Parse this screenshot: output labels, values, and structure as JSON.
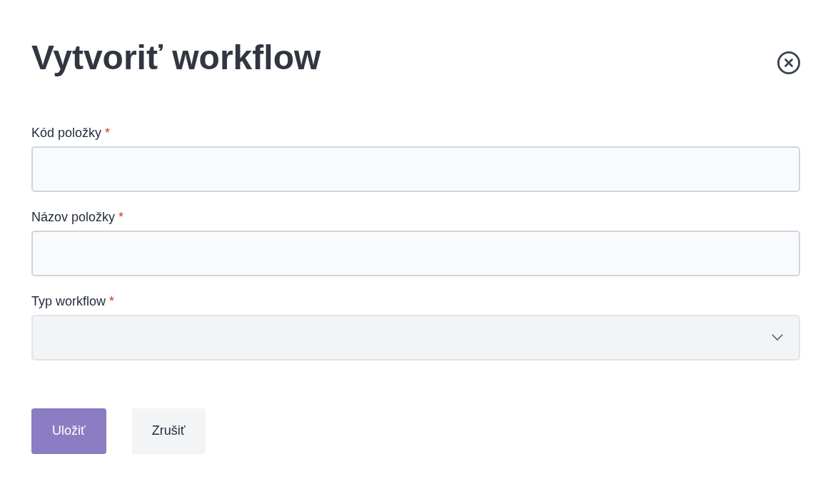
{
  "dialog": {
    "title": "Vytvoriť workflow",
    "fields": [
      {
        "kind": "text",
        "label": "Kód položky",
        "required_mark": "*"
      },
      {
        "kind": "text",
        "label": "Názov položky",
        "required_mark": "*"
      },
      {
        "kind": "select",
        "label": "Typ workflow",
        "required_mark": "*"
      }
    ],
    "buttons": [
      {
        "kind": "primary",
        "label": "Uložiť"
      },
      {
        "kind": "secondary",
        "label": "Zrušiť"
      }
    ]
  }
}
